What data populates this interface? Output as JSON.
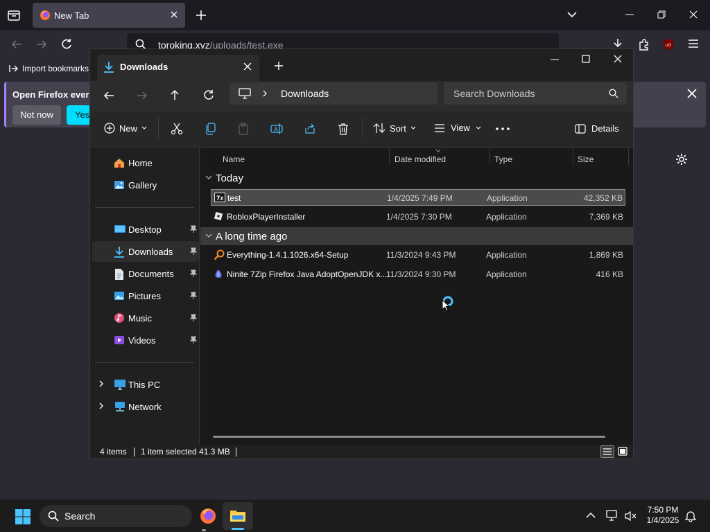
{
  "firefox": {
    "tab_title": "New Tab",
    "url_main": "toroking.xyz",
    "url_path": "/uploads/test.exe",
    "bookmarks": {
      "import_label": "Import bookmarks"
    },
    "banner": {
      "text": "Open Firefox every",
      "not_now": "Not now",
      "yes": "Yes,"
    },
    "accent_color": "#a67dff"
  },
  "explorer": {
    "tab_title": "Downloads",
    "breadcrumb": "Downloads",
    "search_placeholder": "Search Downloads",
    "commands": {
      "new": "New",
      "sort": "Sort",
      "view": "View",
      "details": "Details"
    },
    "nav": {
      "home": "Home",
      "gallery": "Gallery",
      "desktop": "Desktop",
      "downloads": "Downloads",
      "documents": "Documents",
      "pictures": "Pictures",
      "music": "Music",
      "videos": "Videos",
      "this_pc": "This PC",
      "network": "Network"
    },
    "columns": {
      "name": "Name",
      "date": "Date modified",
      "type": "Type",
      "size": "Size"
    },
    "groups": [
      {
        "label": "Today",
        "files": [
          {
            "name": "test",
            "date": "1/4/2025 7:49 PM",
            "type": "Application",
            "size": "42,352 KB",
            "icon": "7zip-sfx-icon",
            "selected": true
          },
          {
            "name": "RobloxPlayerInstaller",
            "date": "1/4/2025 7:30 PM",
            "type": "Application",
            "size": "7,369 KB",
            "icon": "roblox-icon",
            "selected": false
          }
        ]
      },
      {
        "label": "A long time ago",
        "files": [
          {
            "name": "Everything-1.4.1.1026.x64-Setup",
            "date": "11/3/2024 9:43 PM",
            "type": "Application",
            "size": "1,869 KB",
            "icon": "everything-magnifier-icon",
            "selected": false
          },
          {
            "name": "Ninite 7Zip Firefox Java AdoptOpenJDK x...",
            "date": "11/3/2024 9:30 PM",
            "type": "Application",
            "size": "416 KB",
            "icon": "ninite-icon",
            "selected": false
          }
        ]
      }
    ],
    "status": {
      "items": "4 items",
      "selection": "1 item selected  41.3 MB"
    }
  },
  "taskbar": {
    "search_label": "Search",
    "time": "7:50 PM",
    "date": "1/4/2025"
  }
}
